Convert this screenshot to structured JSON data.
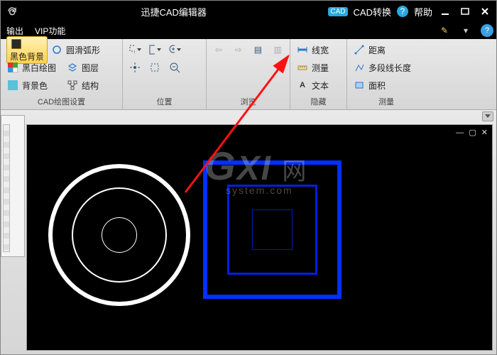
{
  "titlebar": {
    "title": "迅捷CAD编辑器",
    "cad_convert": "CAD转换",
    "help": "帮助"
  },
  "menubar": {
    "output": "输出",
    "vip": "VIP功能"
  },
  "ribbon": {
    "g1": {
      "black_bg": "黑色背景",
      "arc": "圆滑弧形",
      "bw": "黑白绘图",
      "layer": "图层",
      "bgcolor": "背景色",
      "struct": "结构",
      "label": "CAD绘图设置"
    },
    "g2": {
      "label": "位置"
    },
    "g3": {
      "label": "浏览"
    },
    "g4": {
      "linewidth": "线宽",
      "measure": "测量",
      "text": "文本",
      "label": "隐藏"
    },
    "g5": {
      "distance": "距离",
      "polylen": "多段线长度",
      "area": "面积",
      "label": "测量"
    }
  },
  "watermark": {
    "gxi": "GXI",
    "wang": "网",
    "sys": "system.com"
  }
}
